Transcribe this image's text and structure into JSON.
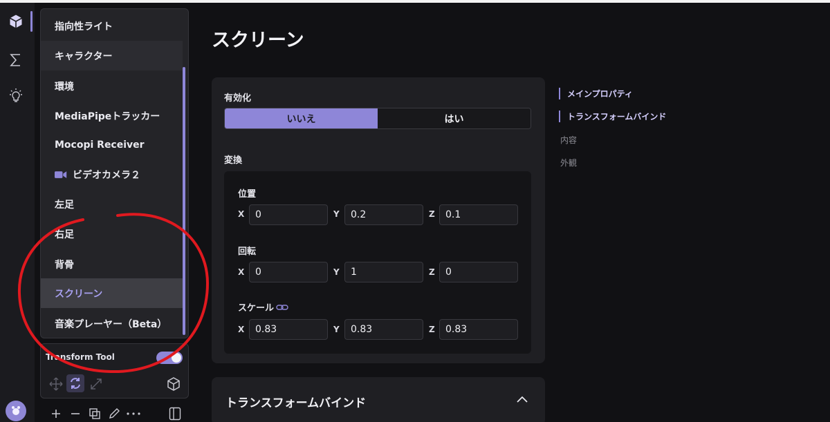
{
  "sidebar_list": {
    "items": [
      {
        "label": "指向性ライト"
      },
      {
        "label": "キャラクター"
      },
      {
        "label": "環境"
      },
      {
        "label": "MediaPipeトラッカー"
      },
      {
        "label": "Mocopi Receiver"
      },
      {
        "label": "ビデオカメラ２",
        "icon": "video-camera-icon"
      },
      {
        "label": "左足"
      },
      {
        "label": "右足"
      },
      {
        "label": "背骨"
      },
      {
        "label": "スクリーン"
      },
      {
        "label": "音楽プレーヤー（Beta）"
      }
    ],
    "selected_label": "スクリーン",
    "hovered_label": "キャラクター"
  },
  "tool": {
    "label": "Transform Tool",
    "enabled": true
  },
  "page": {
    "title": "スクリーン"
  },
  "properties": {
    "enable_label": "有効化",
    "enable_options": [
      "いいえ",
      "はい"
    ],
    "enable_selected": "いいえ",
    "transform_label": "変換",
    "position": {
      "label": "位置",
      "x": "0",
      "y": "0.2",
      "z": "0.1"
    },
    "rotation": {
      "label": "回転",
      "x": "0",
      "y": "1",
      "z": "0"
    },
    "scale": {
      "label": "スケール",
      "x": "0.83",
      "y": "0.83",
      "z": "0.83"
    },
    "axis_labels": [
      "X",
      "Y",
      "Z"
    ]
  },
  "section2": {
    "title": "トランスフォームバインド"
  },
  "toc": {
    "items": [
      {
        "label": "メインプロパティ",
        "active": true
      },
      {
        "label": "トランスフォームバインド",
        "active": true
      },
      {
        "label": "内容",
        "active": false
      },
      {
        "label": "外観",
        "active": false
      }
    ]
  },
  "colors": {
    "accent": "#8e86d8",
    "background": "#111114",
    "annotation": "#e0191f"
  }
}
